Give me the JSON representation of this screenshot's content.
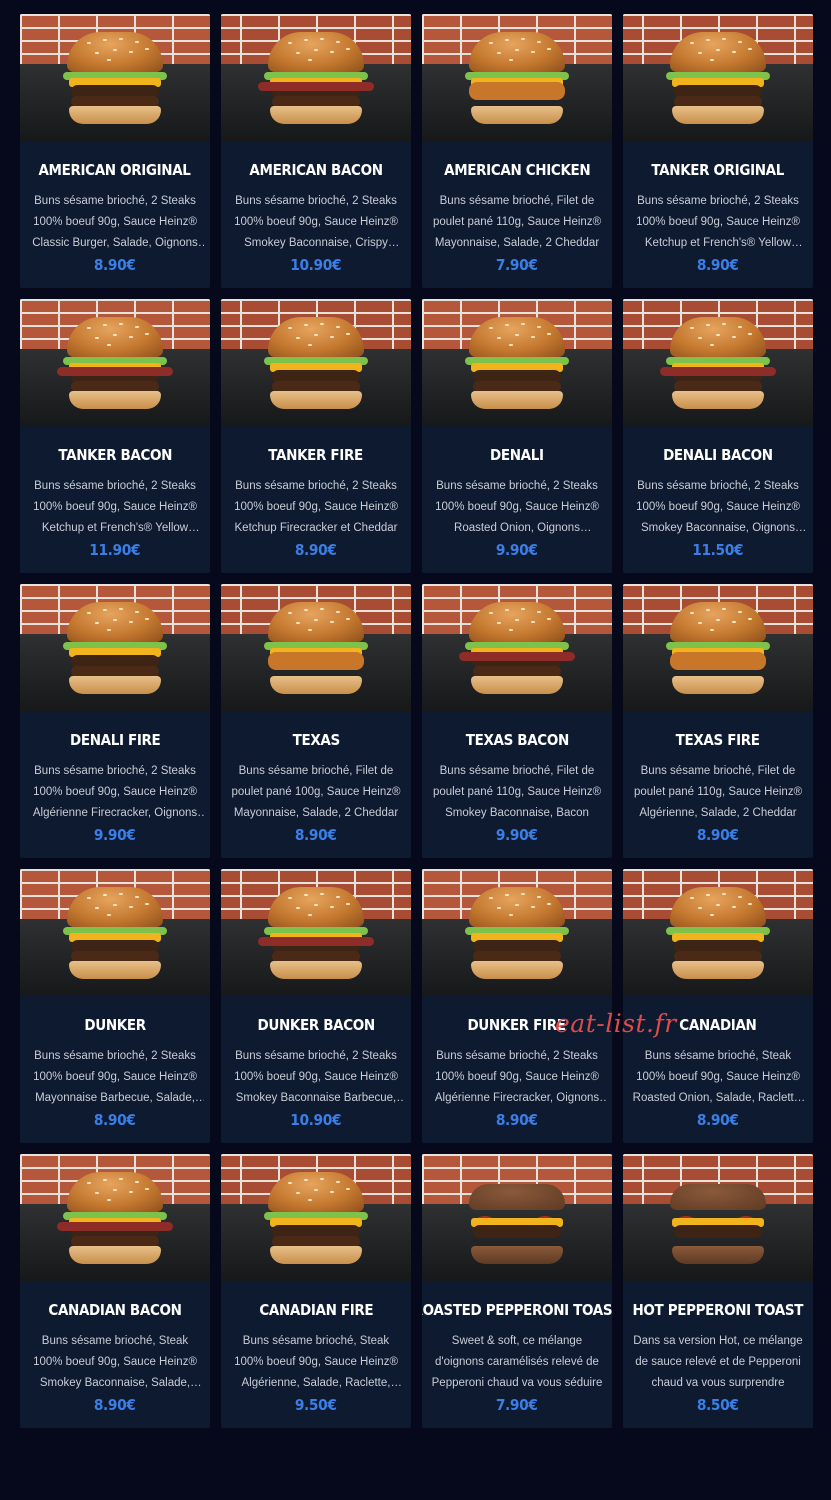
{
  "products": [
    {
      "name": "AMERICAN ORIGINAL",
      "desc": "Buns sésame brioché, 2 Steaks 100% boeuf 90g, Sauce Heinz® Classic Burger, Salade, Oignons rouges, Cheddar",
      "price": "8.90€",
      "style": "double"
    },
    {
      "name": "AMERICAN BACON",
      "desc": "Buns sésame brioché, 2 Steaks 100% boeuf 90g, Sauce Heinz® Smokey Baconnaise, Crispy Bacon, Cheddar",
      "price": "10.90€",
      "style": "bacon"
    },
    {
      "name": "AMERICAN CHICKEN",
      "desc": "Buns sésame brioché, Filet de poulet pané 110g, Sauce Heinz® Mayonnaise, Salade, 2 Cheddar",
      "price": "7.90€",
      "style": "chicken"
    },
    {
      "name": "TANKER ORIGINAL",
      "desc": "Buns sésame brioché, 2 Steaks 100% boeuf 90g, Sauce Heinz® Ketchup et French's® Yellow Mustard",
      "price": "8.90€",
      "style": "double"
    },
    {
      "name": "TANKER BACON",
      "desc": "Buns sésame brioché, 2 Steaks 100% boeuf 90g, Sauce Heinz® Ketchup et French's® Yellow Mustard, Bacon",
      "price": "11.90€",
      "style": "bacon"
    },
    {
      "name": "TANKER FIRE",
      "desc": "Buns sésame brioché, 2 Steaks 100% boeuf 90g, Sauce Heinz® Ketchup Firecracker et Cheddar",
      "price": "8.90€",
      "style": "double"
    },
    {
      "name": "DENALI",
      "desc": "Buns sésame brioché, 2 Steaks 100% boeuf 90g, Sauce Heinz® Roasted Onion, Oignons caramélisés",
      "price": "9.90€",
      "style": "double"
    },
    {
      "name": "DENALI BACON",
      "desc": "Buns sésame brioché, 2 Steaks 100% boeuf 90g, Sauce Heinz® Smokey Baconnaise, Oignons caramélisés",
      "price": "11.50€",
      "style": "bacon"
    },
    {
      "name": "DENALI FIRE",
      "desc": "Buns sésame brioché, 2 Steaks 100% boeuf 90g, Sauce Heinz® Algérienne Firecracker, Oignons caramélisés",
      "price": "9.90€",
      "style": "double"
    },
    {
      "name": "TEXAS",
      "desc": "Buns sésame brioché, Filet de poulet pané 100g, Sauce Heinz® Mayonnaise, Salade, 2 Cheddar",
      "price": "8.90€",
      "style": "chicken"
    },
    {
      "name": "TEXAS BACON",
      "desc": "Buns sésame brioché, Filet de poulet pané 110g, Sauce Heinz® Smokey Baconnaise, Bacon",
      "price": "9.90€",
      "style": "bacon"
    },
    {
      "name": "TEXAS FIRE",
      "desc": "Buns sésame brioché, Filet de poulet pané 110g, Sauce Heinz® Algérienne, Salade, 2 Cheddar",
      "price": "8.90€",
      "style": "chicken"
    },
    {
      "name": "DUNKER",
      "desc": "Buns sésame brioché, 2 Steaks 100% boeuf 90g, Sauce Heinz® Mayonnaise Barbecue, Salade, Cheddar",
      "price": "8.90€",
      "style": "double"
    },
    {
      "name": "DUNKER BACON",
      "desc": "Buns sésame brioché, 2 Steaks 100% boeuf 90g, Sauce Heinz® Smokey Baconnaise Barbecue, Bacon",
      "price": "10.90€",
      "style": "bacon"
    },
    {
      "name": "DUNKER FIRE",
      "desc": "Buns sésame brioché, 2 Steaks 100% boeuf 90g, Sauce Heinz® Algérienne Firecracker, Oignons rouges",
      "price": "8.90€",
      "style": "double"
    },
    {
      "name": "CANADIAN",
      "desc": "Buns sésame brioché, Steak 100% boeuf 90g, Sauce Heinz® Roasted Onion, Salade, Raclette, Galette de pomme de terre",
      "price": "8.90€",
      "style": "double"
    },
    {
      "name": "CANADIAN BACON",
      "desc": "Buns sésame brioché, Steak 100% boeuf 90g, Sauce Heinz® Smokey Baconnaise, Salade, Raclette",
      "price": "8.90€",
      "style": "bacon"
    },
    {
      "name": "CANADIAN FIRE",
      "desc": "Buns sésame brioché, Steak 100% boeuf 90g, Sauce Heinz® Algérienne, Salade, Raclette, Galette",
      "price": "9.50€",
      "style": "double"
    },
    {
      "name": "ROASTED PEPPERONI TOAST",
      "desc": "Sweet & soft, ce mélange d'oignons caramélisés relevé de Pepperoni chaud va vous séduire",
      "price": "7.90€",
      "style": "toast"
    },
    {
      "name": "HOT PEPPERONI TOAST",
      "desc": "Dans sa version Hot, ce mélange de sauce relevé et de Pepperoni chaud va vous surprendre",
      "price": "8.50€",
      "style": "toast"
    }
  ],
  "watermark": "eat-list.fr"
}
